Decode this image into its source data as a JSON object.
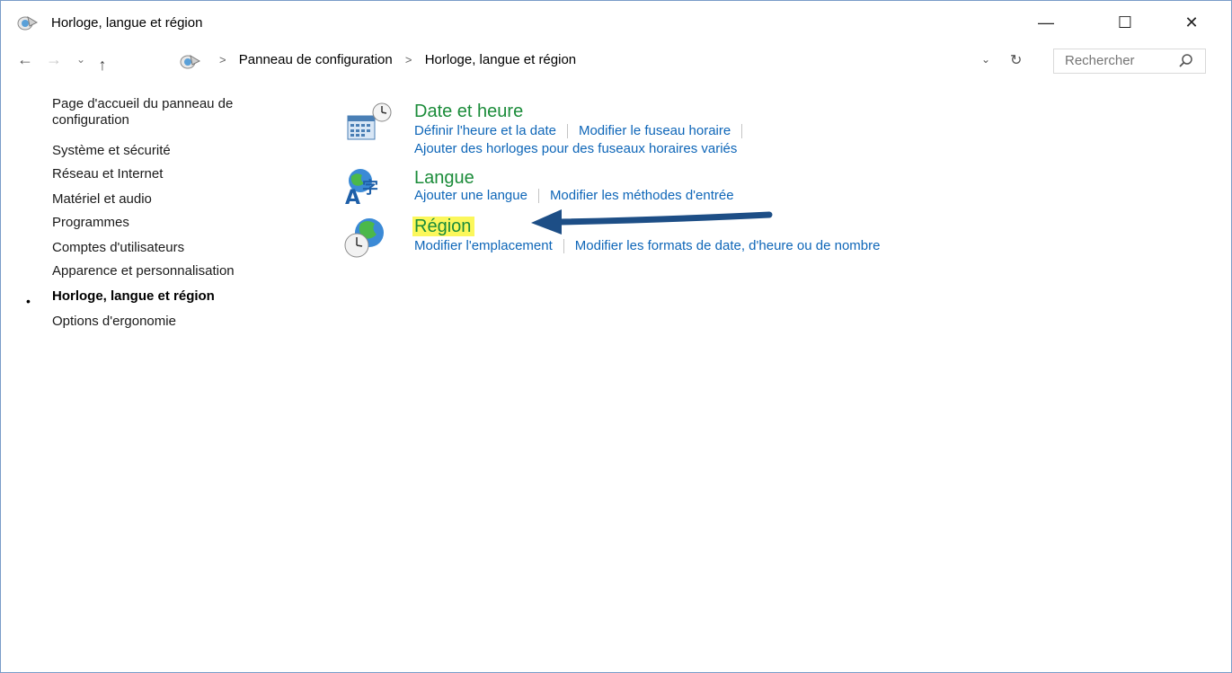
{
  "window": {
    "title": "Horloge, langue et région",
    "controls": {
      "minimize": "—",
      "maximize": "☐",
      "close": "✕"
    }
  },
  "navigation": {
    "back": "←",
    "forward": "→",
    "recent": "⌄",
    "up": "↑",
    "breadcrumb": [
      "Panneau de configuration",
      "Horloge, langue et région"
    ],
    "separator": ">",
    "dropdown": "⌄",
    "refresh": "↻",
    "search_placeholder": "Rechercher"
  },
  "sidebar": {
    "items": [
      {
        "label": "Page d'accueil du panneau de",
        "label2": "configuration"
      },
      {
        "label": "Système et sécurité"
      },
      {
        "label": "Réseau et Internet"
      },
      {
        "label": "Matériel et audio"
      },
      {
        "label": "Programmes"
      },
      {
        "label": "Comptes d'utilisateurs"
      },
      {
        "label": "Apparence et personnalisation"
      },
      {
        "label": "Horloge, langue et région",
        "active": true
      },
      {
        "label": "Options d'ergonomie"
      }
    ],
    "bullet": "•"
  },
  "categories": [
    {
      "title": "Date et heure",
      "icon": "calendar-clock-icon",
      "links": [
        "Définir l'heure et la date",
        "Modifier le fuseau horaire"
      ],
      "links2": [
        "Ajouter des horloges pour des fuseaux horaires variés"
      ]
    },
    {
      "title": "Langue",
      "icon": "language-globe-icon",
      "links": [
        "Ajouter une langue",
        "Modifier les méthodes d'entrée"
      ]
    },
    {
      "title": "Région",
      "icon": "globe-clock-icon",
      "highlighted": true,
      "links": [
        "Modifier l'emplacement",
        "Modifier les formats de date, d'heure ou de nombre"
      ]
    }
  ],
  "colors": {
    "category_title": "#1b8c3a",
    "link": "#0e66b8",
    "highlight": "#fbf75b",
    "arrow": "#1d4e86"
  }
}
